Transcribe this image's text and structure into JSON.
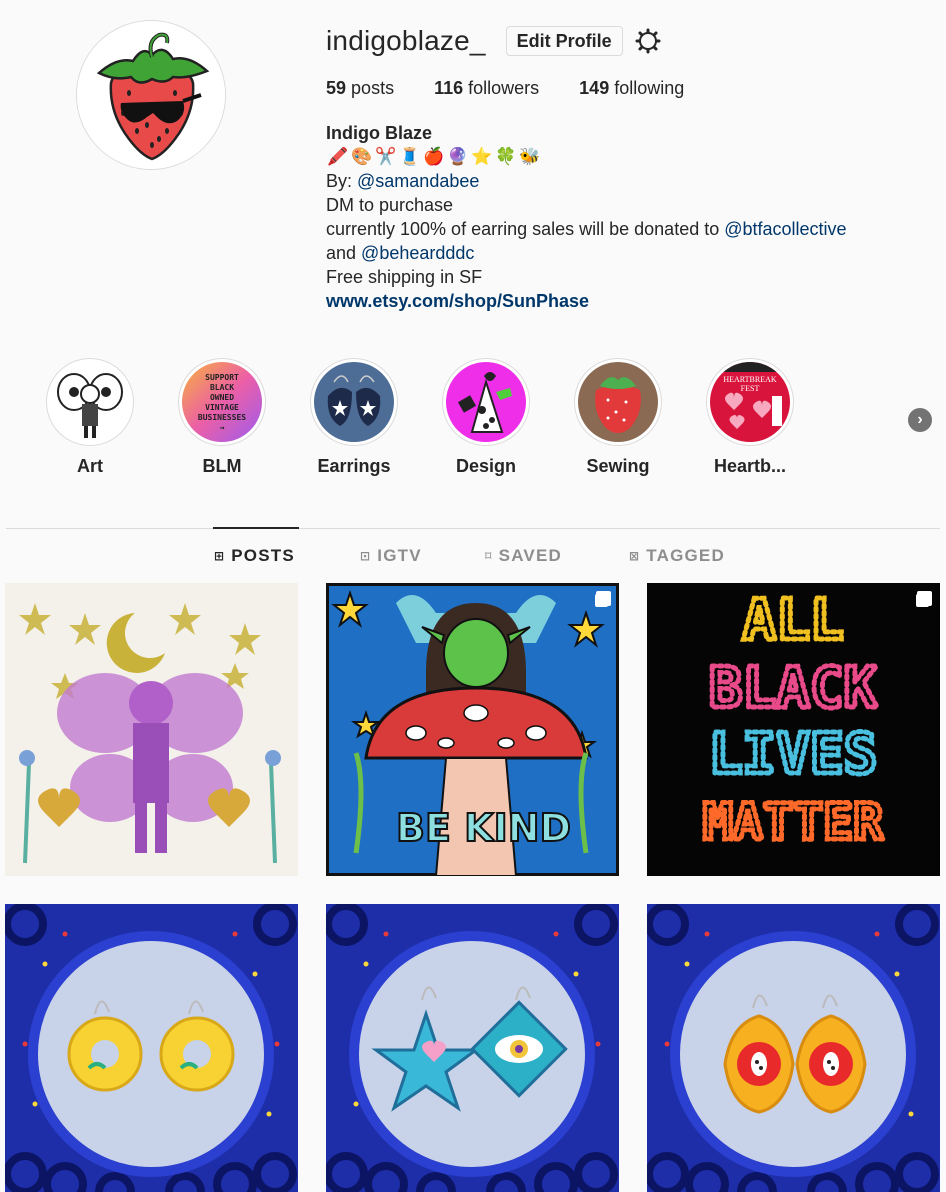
{
  "profile": {
    "username": "indigoblaze_",
    "edit_button": "Edit Profile",
    "settings_icon": "gear-icon",
    "stats": {
      "posts_count": "59",
      "posts_label": "posts",
      "followers_count": "116",
      "followers_label": "followers",
      "following_count": "149",
      "following_label": "following"
    },
    "bio": {
      "name": "Indigo Blaze",
      "emojis": [
        "🖍️",
        "🎨",
        "✂️",
        "🧵",
        "🍎",
        "🔮",
        "⭐",
        "🍀",
        "🐝"
      ],
      "by_prefix": "By: ",
      "by_link": "@samandabee",
      "line_dm": "DM to purchase",
      "line_donate_prefix": "currently 100% of earring sales will be donated to ",
      "donate_link_1": "@btfacollective",
      "line_and": "and ",
      "donate_link_2": "@beheardddc",
      "line_shipping": "Free shipping in SF",
      "website": "www.etsy.com/shop/SunPhase"
    }
  },
  "highlights": [
    {
      "label": "Art"
    },
    {
      "label": "BLM",
      "text_lines": [
        "SUPPORT",
        "BLACK",
        "OWNED",
        "VINTAGE",
        "BUSINESSES",
        "→"
      ]
    },
    {
      "label": "Earrings"
    },
    {
      "label": "Design"
    },
    {
      "label": "Sewing"
    },
    {
      "label": "Heartb...",
      "text_lines": [
        "HEARTBREAK",
        "FEST"
      ]
    }
  ],
  "tabs": [
    {
      "label": "POSTS",
      "icon": "grid-icon",
      "active": true
    },
    {
      "label": "IGTV",
      "icon": "igtv-icon",
      "active": false
    },
    {
      "label": "SAVED",
      "icon": "bookmark-icon",
      "active": false
    },
    {
      "label": "TAGGED",
      "icon": "tag-icon",
      "active": false
    }
  ],
  "posts": [
    {
      "subject": "fairy-print",
      "multi": false
    },
    {
      "subject": "be-kind-painting",
      "multi": true,
      "text": "BE KIND"
    },
    {
      "subject": "sequin-blm",
      "multi": true,
      "text_lines": [
        "ALL",
        "BLACK",
        "LIVES",
        "MATTER"
      ]
    },
    {
      "subject": "yellow-earrings",
      "multi": false
    },
    {
      "subject": "star-eye-earrings",
      "multi": false
    },
    {
      "subject": "apple-earrings",
      "multi": false
    }
  ],
  "colors": {
    "link": "#00376b",
    "text": "#262626",
    "muted": "#8e8e8e",
    "background": "#fafafa",
    "border": "#dbdbdb"
  }
}
